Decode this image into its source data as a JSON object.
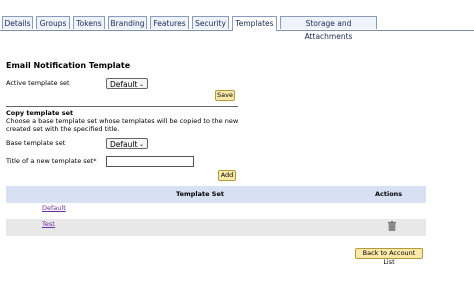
{
  "tabs": [
    {
      "label": "Details"
    },
    {
      "label": "Groups"
    },
    {
      "label": "Tokens"
    },
    {
      "label": "Branding"
    },
    {
      "label": "Features"
    },
    {
      "label": "Security"
    },
    {
      "label": "Templates"
    },
    {
      "label": "Storage and Attachments"
    }
  ],
  "active_tab": "Templates",
  "page_title": "Email Notification Template",
  "active_template": {
    "label": "Active template set",
    "value": "Default",
    "save_label": "Save"
  },
  "copy": {
    "heading": "Copy template set",
    "description": "Choose a base template set whose templates will be copied to the new created set with the specified title.",
    "base_label": "Base template set",
    "base_value": "Default",
    "title_label": "Title of a new template set*",
    "title_value": "",
    "add_label": "Add"
  },
  "table": {
    "headers": {
      "template_set": "Template Set",
      "actions": "Actions"
    },
    "rows": [
      {
        "name": "Default",
        "has_delete": false
      },
      {
        "name": "Test",
        "has_delete": true
      }
    ]
  },
  "back_label": "Back to Account List"
}
